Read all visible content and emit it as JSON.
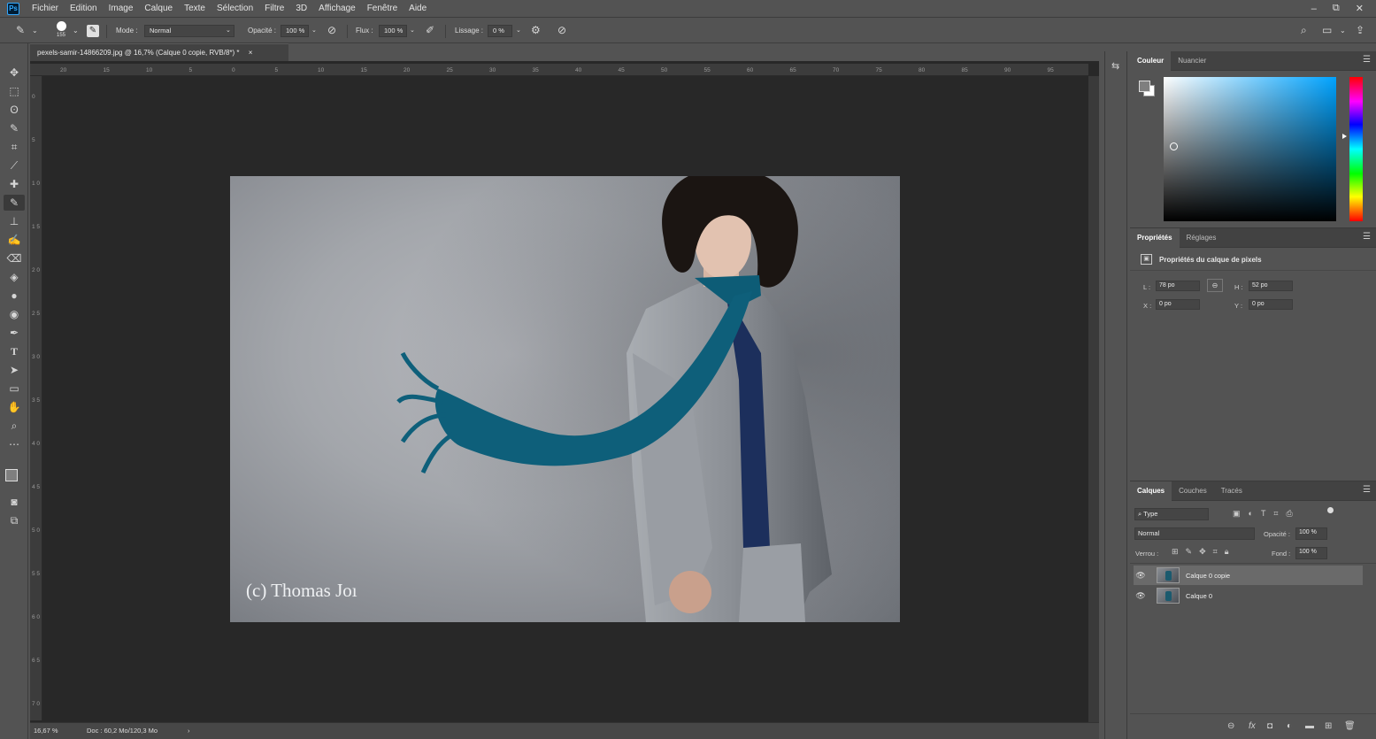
{
  "menu": {
    "logo": "Ps",
    "items": [
      "Fichier",
      "Edition",
      "Image",
      "Calque",
      "Texte",
      "Sélection",
      "Filtre",
      "3D",
      "Affichage",
      "Fenêtre",
      "Aide"
    ]
  },
  "window_controls": {
    "minimize": "–",
    "restore": "⧉",
    "close": "✕"
  },
  "options": {
    "brush_size": "155",
    "mode_label": "Mode :",
    "mode_value": "Normal",
    "opacity_label": "Opacité :",
    "opacity_value": "100 %",
    "flux_label": "Flux :",
    "flux_value": "100 %",
    "lissage_label": "Lissage :",
    "lissage_value": "0 %"
  },
  "document": {
    "tab_title": "pexels-samir-14866209.jpg @ 16,7% (Calque 0 copie, RVB/8*) *",
    "tab_close": "×",
    "watermark": "(c) Thomas Joı",
    "zoom": "16,67 %",
    "doc_info": "Doc : 60,2 Mo/120,3 Mo",
    "status_arrow": "›"
  },
  "ruler": {
    "h_ticks": [
      "20",
      "15",
      "10",
      "5",
      "0",
      "5",
      "10",
      "15",
      "20",
      "25",
      "30",
      "35",
      "40",
      "45",
      "50",
      "55",
      "60",
      "65",
      "70",
      "75",
      "80",
      "85",
      "90",
      "95"
    ],
    "v_ticks": [
      "0",
      "5",
      "1 0",
      "1 5",
      "2 0",
      "2 5",
      "3 0",
      "3 5",
      "4 0",
      "4 5",
      "5 0",
      "5 5",
      "6 0",
      "6 5",
      "7 0"
    ]
  },
  "color_panel": {
    "tabs": [
      "Couleur",
      "Nuancier"
    ],
    "foreground": "#7f7f7f",
    "background": "#ffffff",
    "hue_color": "#00a3ff"
  },
  "properties_panel": {
    "tabs": [
      "Propriétés",
      "Réglages"
    ],
    "title": "Propriétés du calque de pixels",
    "L_label": "L :",
    "L_value": "78 po",
    "H_label": "H :",
    "H_value": "52 po",
    "X_label": "X :",
    "X_value": "0 po",
    "Y_label": "Y :",
    "Y_value": "0 po"
  },
  "layers_panel": {
    "tabs": [
      "Calques",
      "Couches",
      "Tracés"
    ],
    "filter_value": "Type",
    "blend_mode": "Normal",
    "opacity_label": "Opacité :",
    "opacity_value": "100 %",
    "lock_label": "Verrou :",
    "fill_label": "Fond :",
    "fill_value": "100 %",
    "layers": [
      {
        "name": "Calque 0 copie",
        "selected": true
      },
      {
        "name": "Calque 0",
        "selected": false
      }
    ]
  },
  "tools": [
    "move-tool",
    "marquee-tool",
    "lasso-tool",
    "quick-selection-tool",
    "crop-tool",
    "eyedropper-tool",
    "healing-brush-tool",
    "brush-tool",
    "clone-stamp-tool",
    "history-brush-tool",
    "eraser-tool",
    "paint-bucket-tool",
    "blur-tool",
    "dodge-tool",
    "pen-tool",
    "type-tool",
    "path-selection-tool",
    "rectangle-tool",
    "hand-tool",
    "zoom-tool",
    "more-tools"
  ]
}
